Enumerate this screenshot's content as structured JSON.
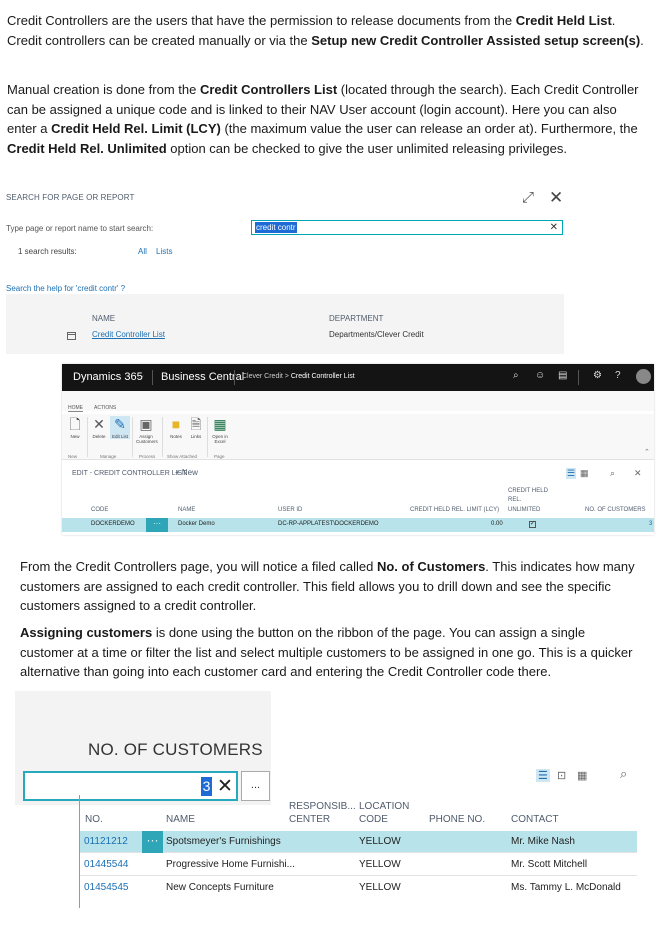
{
  "paragraphs": {
    "p1": {
      "a": "Credit Controllers are the users that have the permission to release documents from the ",
      "b1": "Credit Held List",
      "c": ". Credit controllers can be created manually or via the ",
      "b2": "Setup new Credit Controller Assisted setup screen(s)",
      "d": "."
    },
    "p2": {
      "a": "Manual creation is done from the ",
      "b1": "Credit Controllers List",
      "c": " (located through the search). Each Credit Controller can be assigned a unique code and is linked to their NAV User account (login account). Here you can also enter a ",
      "b2": "Credit Held Rel. Limit (LCY)",
      "d": " (the maximum value the user can release an order at). Furthermore, the ",
      "b3": "Credit Held Rel. Unlimited",
      "e": " option can be checked to give the user unlimited releasing privileges."
    },
    "p3": {
      "a": "From the Credit Controllers page, you will notice a filed called ",
      "b1": "No. of Customers",
      "c": ". This indicates how many customers are assigned to each credit controller. This field allows you to drill down and see the specific customers assigned to a credit controller."
    },
    "p4": {
      "b1": "Assigning customers",
      "a": " is done using the button on the ribbon of the page. You can assign a single customer at a time or filter the list and select multiple customers to be assigned in one go. This is a quicker alternative than going into each customer card and entering the Credit Controller code there."
    }
  },
  "search": {
    "header": "SEARCH FOR PAGE OR REPORT",
    "label": "Type page or report name to start search:",
    "value": "credit contr",
    "results": "1 search results:",
    "filters": [
      "All",
      "Lists"
    ],
    "help": "Search the help for 'credit contr' ?",
    "columns": [
      "NAME",
      "DEPARTMENT"
    ],
    "row": {
      "name": "Credit Controller List",
      "department": "Departments/Clever Credit"
    }
  },
  "bc": {
    "product": "Dynamics 365",
    "app": "Business Central",
    "crumb1": "Clever Credit",
    "crumb2": "Credit Controller List",
    "tabs": [
      "HOME",
      "ACTIONS"
    ],
    "ribbon": [
      {
        "label": "New",
        "icon": "new-document-icon"
      },
      {
        "label": "Delete",
        "icon": "delete-icon"
      },
      {
        "label": "Edit List",
        "icon": "edit-list-icon"
      },
      {
        "label": "Assign Customers",
        "icon": "assign-customers-icon"
      },
      {
        "label": "Notes",
        "icon": "notes-icon"
      },
      {
        "label": "Links",
        "icon": "links-icon"
      },
      {
        "label": "Open in Excel",
        "icon": "excel-icon"
      }
    ],
    "groups": [
      "New",
      "Manage",
      "Process",
      "Show Attached",
      "Page"
    ],
    "page_title": "EDIT - CREDIT CONTROLLER LIST",
    "new_label": "+ New",
    "columns": {
      "code": "CODE",
      "name": "NAME",
      "user": "USER ID",
      "limit": "CREDIT HELD REL. LIMIT (LCY)",
      "unl1": "CREDIT HELD",
      "unl2": "REL.",
      "unl3": "UNLIMITED",
      "cust": "NO. OF CUSTOMERS"
    },
    "row": {
      "code": "DOCKERDEMO",
      "dots": "···",
      "name": "Docker Demo",
      "user": "DC-RP-APPLATEST\\DOCKERDEMO",
      "limit": "0.00",
      "unlimited": "✓",
      "customers": "3"
    }
  },
  "customers": {
    "filter_title": "NO. OF CUSTOMERS",
    "filter_value": "3",
    "more": "...",
    "columns": {
      "no": "NO.",
      "name": "NAME",
      "resp1": "RESPONSIB...",
      "resp2": "CENTER",
      "loc1": "LOCATION",
      "loc2": "CODE",
      "phone": "PHONE NO.",
      "contact": "CONTACT"
    },
    "rows": [
      {
        "no": "01121212",
        "name": "Spotsmeyer's Furnishings",
        "location": "YELLOW",
        "contact": "Mr. Mike Nash"
      },
      {
        "no": "01445544",
        "name": "Progressive Home Furnishi...",
        "location": "YELLOW",
        "contact": "Mr. Scott Mitchell"
      },
      {
        "no": "01454545",
        "name": "New Concepts Furniture",
        "location": "YELLOW",
        "contact": "Ms. Tammy L. McDonald"
      }
    ],
    "dots": "···"
  }
}
